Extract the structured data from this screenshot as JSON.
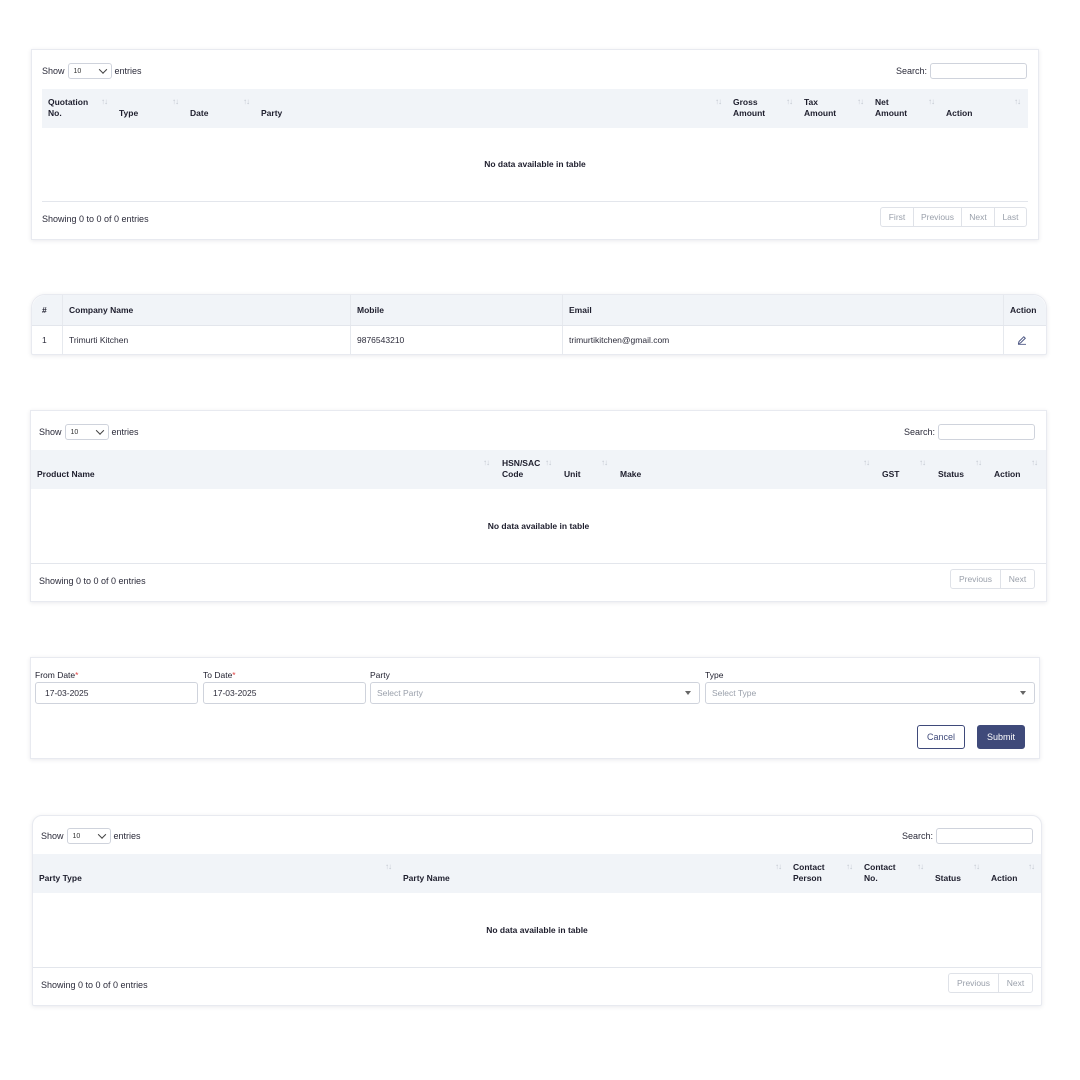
{
  "common": {
    "show": "Show",
    "entries": "entries",
    "length_value": "10",
    "search_label": "Search:",
    "empty": "No data available in table",
    "info": "Showing 0 to 0 of 0 entries",
    "sort_glyph": "↑↓"
  },
  "quotations": {
    "headers": {
      "q1": "Quotation",
      "q2": "No.",
      "type": "Type",
      "date": "Date",
      "party": "Party",
      "gross1": "Gross",
      "gross2": "Amount",
      "tax1": "Tax",
      "tax2": "Amount",
      "net1": "Net",
      "net2": "Amount",
      "action": "Action"
    },
    "pager": {
      "first": "First",
      "previous": "Previous",
      "next": "Next",
      "last": "Last"
    }
  },
  "companies": {
    "headers": {
      "num": "#",
      "name": "Company Name",
      "mobile": "Mobile",
      "email": "Email",
      "action": "Action"
    },
    "rows": [
      {
        "num": "1",
        "name": "Trimurti Kitchen",
        "mobile": "9876543210",
        "email": "trimurtikitchen@gmail.com"
      }
    ]
  },
  "products": {
    "headers": {
      "name": "Product Name",
      "hsn1": "HSN/SAC",
      "hsn2": "Code",
      "unit": "Unit",
      "make": "Make",
      "gst": "GST",
      "status": "Status",
      "action": "Action"
    },
    "pager": {
      "previous": "Previous",
      "next": "Next"
    }
  },
  "filter_form": {
    "from_label": "From Date",
    "from_value": "17-03-2025",
    "to_label": "To Date",
    "to_value": "17-03-2025",
    "party_label": "Party",
    "party_placeholder": "Select Party",
    "type_label": "Type",
    "type_placeholder": "Select Type",
    "required_mark": "*",
    "cancel": "Cancel",
    "submit": "Submit"
  },
  "parties": {
    "headers": {
      "ptype": "Party Type",
      "pname": "Party Name",
      "cp1": "Contact",
      "cp2": "Person",
      "cn1": "Contact",
      "cn2": "No.",
      "status": "Status",
      "action": "Action"
    },
    "pager": {
      "previous": "Previous",
      "next": "Next"
    }
  },
  "colors": {
    "primary": "#3f4a7a",
    "header_bg": "#f1f4f8",
    "required": "#e04343"
  }
}
